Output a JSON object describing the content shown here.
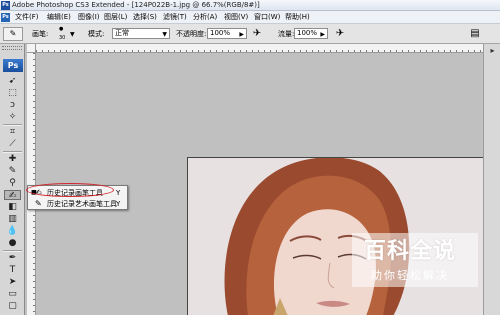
{
  "window": {
    "app_icon": "Ps",
    "title": "Adobe Photoshop CS3 Extended - [124P022B-1.jpg @ 66.7%(RGB/8#)]"
  },
  "menubar": {
    "logo": "Ps",
    "items": [
      "文件(F)",
      "编辑(E)",
      "图像(I)",
      "图层(L)",
      "选择(S)",
      "滤镜(T)",
      "分析(A)",
      "视图(V)",
      "窗口(W)",
      "帮助(H)"
    ]
  },
  "options": {
    "brush_label": "画笔:",
    "brush_size": "30",
    "mode_label": "模式:",
    "mode_value": "正常",
    "opacity_label": "不透明度:",
    "opacity_value": "100%",
    "flow_label": "流量:",
    "flow_value": "100%"
  },
  "toolbox": {
    "logo": "Ps"
  },
  "flyout": {
    "items": [
      {
        "label": "历史记录画笔工具",
        "shortcut": "Y",
        "selected": true
      },
      {
        "label": "历史记录艺术画笔工具",
        "shortcut": "Y",
        "selected": false
      }
    ]
  },
  "watermark": {
    "main": "百科全说",
    "sub": "助你轻松解决"
  },
  "colors": {
    "highlight_ring": "#d2262c",
    "ps_blue": "#1a4f9c"
  }
}
